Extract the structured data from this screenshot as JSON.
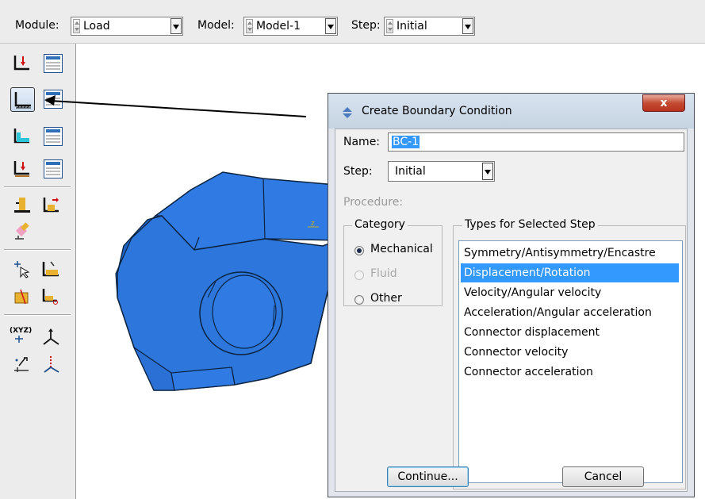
{
  "context_bar": {
    "module_label": "Module:",
    "module_value": "Load",
    "model_label": "Model:",
    "model_value": "Model-1",
    "step_label": "Step:",
    "step_value": "Initial"
  },
  "viewport": {
    "triad_axis_label": "z",
    "part_color": "#2f7be3"
  },
  "toolbox": {
    "icons": [
      "load-manager-icon",
      "boundary-condition-manager-icon",
      "predefined-field-manager-icon",
      "load-case-manager-icon",
      "create-field-icon",
      "create-amplitude-icon",
      "datum-csys-icon",
      "coordinates-icon",
      "query-icon",
      "selection-icon"
    ],
    "coordinates_text": "(XYZ)"
  },
  "dialog": {
    "title": "Create Boundary Condition",
    "close_label": "x",
    "name_label": "Name:",
    "name_value": "BC-1",
    "step_label": "Step:",
    "step_value": "Initial",
    "procedure_label": "Procedure:",
    "category": {
      "title": "Category",
      "options": [
        {
          "label": "Mechanical",
          "selected": true,
          "enabled": true
        },
        {
          "label": "Fluid",
          "selected": false,
          "enabled": false
        },
        {
          "label": "Other",
          "selected": false,
          "enabled": true
        }
      ]
    },
    "types": {
      "title": "Types for Selected Step",
      "items": [
        "Symmetry/Antisymmetry/Encastre",
        "Displacement/Rotation",
        "Velocity/Angular velocity",
        "Acceleration/Angular acceleration",
        "Connector displacement",
        "Connector velocity",
        "Connector acceleration"
      ],
      "selected_index": 1
    },
    "continue_label": "Continue...",
    "cancel_label": "Cancel"
  },
  "colors": {
    "selection": "#3399ff",
    "close_button": "#c44b33",
    "toolbar_bg": "#ececec"
  }
}
